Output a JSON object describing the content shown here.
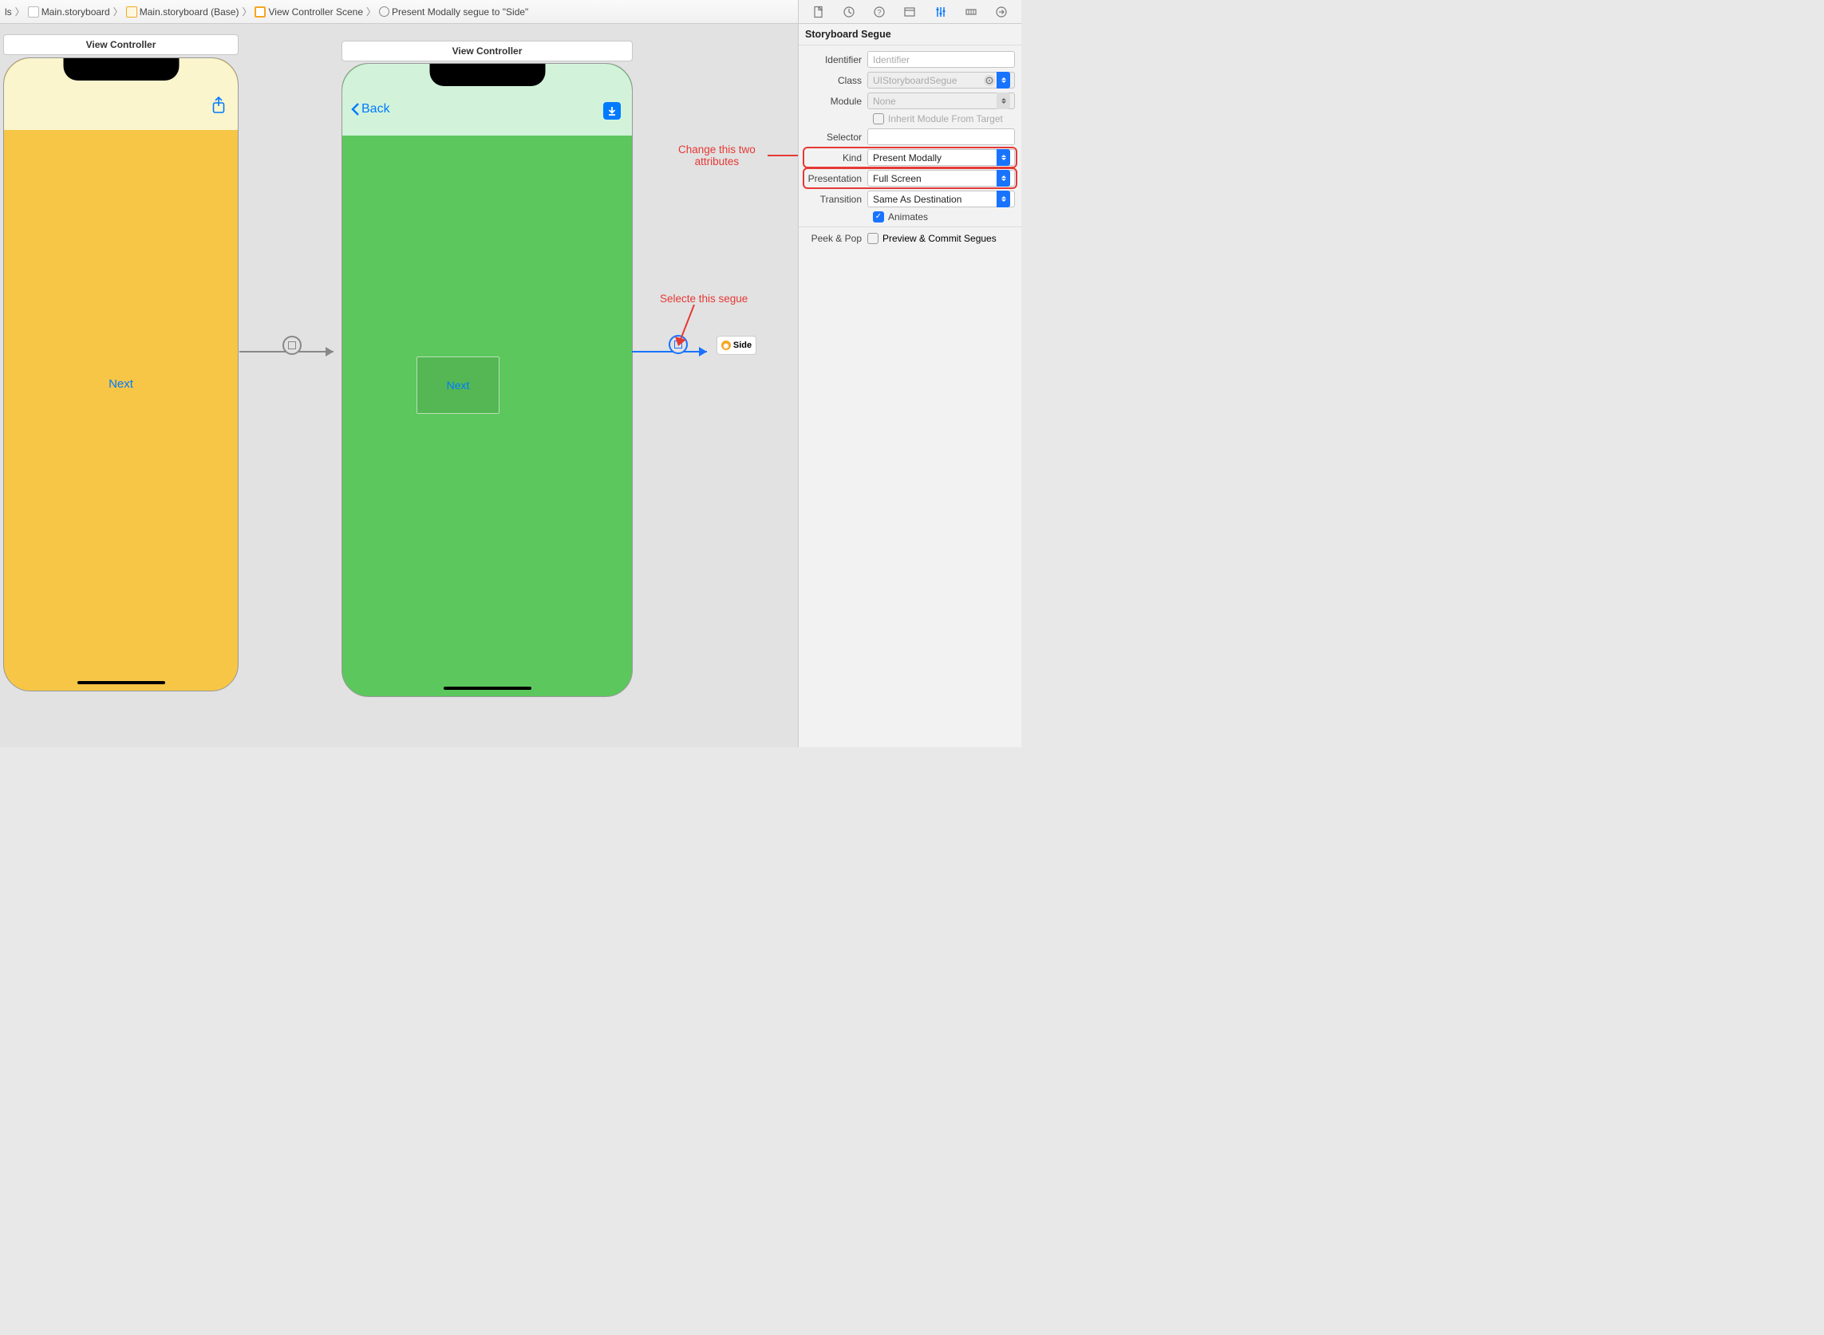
{
  "breadcrumbs": {
    "item0": "ls",
    "item1": "Main.storyboard",
    "item2": "Main.storyboard (Base)",
    "item3": "View Controller Scene",
    "item4": "Present Modally segue to \"Side\""
  },
  "canvas": {
    "vc1_title": "View Controller",
    "vc2_title": "View Controller",
    "phone1_next": "Next",
    "phone2_back": "Back",
    "phone2_next": "Next",
    "side_card": "Side"
  },
  "annotations": {
    "change_attrs": "Change this two\nattributes",
    "select_segue": "Selecte this segue"
  },
  "inspector": {
    "section_title": "Storyboard Segue",
    "labels": {
      "identifier": "Identifier",
      "cls": "Class",
      "module": "Module",
      "inherit": "Inherit Module From Target",
      "selector": "Selector",
      "kind": "Kind",
      "presentation": "Presentation",
      "transition": "Transition",
      "animates": "Animates",
      "peek": "Peek & Pop",
      "preview": "Preview & Commit Segues"
    },
    "values": {
      "identifier_placeholder": "Identifier",
      "cls_placeholder": "UIStoryboardSegue",
      "module_placeholder": "None",
      "selector": "",
      "kind": "Present Modally",
      "presentation": "Full Screen",
      "transition": "Same As Destination",
      "animates_checked": true,
      "inherit_checked": false,
      "preview_checked": false
    }
  }
}
